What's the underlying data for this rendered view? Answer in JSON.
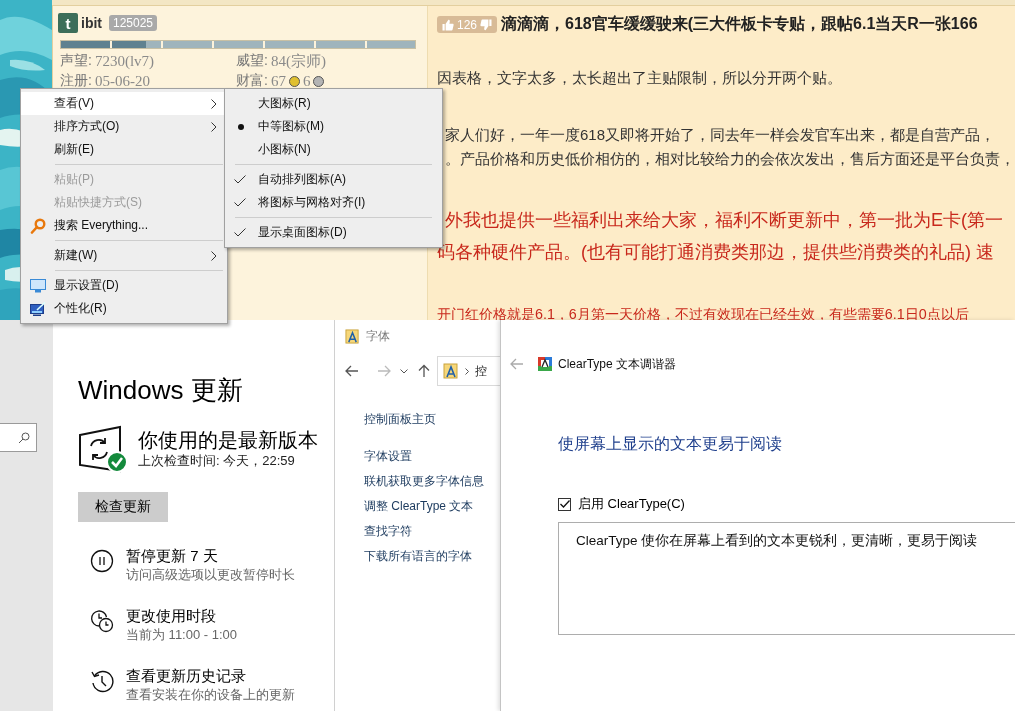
{
  "forum_post": {
    "author": {
      "avatar_letter": "t",
      "name": "ibit",
      "badge": "125025",
      "level": 0.24,
      "stats": [
        {
          "label": "声望:",
          "value": "7230(lv7)"
        },
        {
          "label": "威望:",
          "value": "84(宗师)"
        },
        {
          "label": "注册:",
          "value": "05-06-20"
        }
      ],
      "wealth": {
        "label": "财富:",
        "coins": [
          {
            "amount": "67",
            "color": "#e0c030"
          },
          {
            "amount": "6",
            "color": "#b4b4b4"
          }
        ]
      }
    },
    "votes": "126",
    "title": "滴滴滴，618官车缓缓驶来(三大件板卡专贴，跟帖6.1当天R一张166",
    "paragraphs": [
      {
        "kind": "normal",
        "lines": [
          "因表格，文字太多，太长超出了主贴限制，所以分开两个贴。"
        ]
      },
      {
        "kind": "normal",
        "lines": [
          "家人们好，一年一度618又即将开始了，同去年一样会发官车出来，都是自营产品，",
          "。产品价格和历史低价相仿的，相对比较给力的会依次发出，售后方面还是平台负责，"
        ]
      },
      {
        "kind": "highlight",
        "lines": [
          "外我也提供一些福利出来给大家，福利不断更新中，第一批为E卡(第一",
          "码各种硬件产品。(也有可能打通消费类那边，提供些消费类的礼品) 速"
        ]
      },
      {
        "kind": "highlight",
        "lines": [
          "开门红价格就是6.1，6月第一天价格，不过有效现在已经生效，有些需要6.1日0点以后"
        ]
      }
    ]
  },
  "context_menu": {
    "items": [
      {
        "kind": "item",
        "label": "查看(V)",
        "submenu": true,
        "selected": true,
        "disabled": false
      },
      {
        "kind": "item",
        "label": "排序方式(O)",
        "submenu": true,
        "selected": false,
        "disabled": false
      },
      {
        "kind": "item",
        "label": "刷新(E)",
        "submenu": false,
        "selected": false,
        "disabled": false
      },
      {
        "kind": "separator"
      },
      {
        "kind": "item",
        "label": "粘贴(P)",
        "submenu": false,
        "selected": false,
        "disabled": true
      },
      {
        "kind": "item",
        "label": "粘贴快捷方式(S)",
        "submenu": false,
        "selected": false,
        "disabled": true
      },
      {
        "kind": "search",
        "label": "搜索 Everything...",
        "submenu": false,
        "selected": false,
        "disabled": false
      },
      {
        "kind": "separator"
      },
      {
        "kind": "item",
        "label": "新建(W)",
        "submenu": true,
        "selected": false,
        "disabled": false
      },
      {
        "kind": "separator"
      },
      {
        "kind": "display",
        "label": "显示设置(D)",
        "submenu": false,
        "selected": false,
        "disabled": false
      },
      {
        "kind": "personalize",
        "label": "个性化(R)",
        "submenu": false,
        "selected": false,
        "disabled": false
      }
    ]
  },
  "view_submenu": {
    "items": [
      {
        "kind": "radio",
        "label": "大图标(R)",
        "selected": false
      },
      {
        "kind": "radio",
        "label": "中等图标(M)",
        "selected": true
      },
      {
        "kind": "radio",
        "label": "小图标(N)",
        "selected": false
      },
      {
        "kind": "separator"
      },
      {
        "kind": "check",
        "label": "自动排列图标(A)",
        "checked": true
      },
      {
        "kind": "check",
        "label": "将图标与网格对齐(I)",
        "checked": true
      },
      {
        "kind": "separator"
      },
      {
        "kind": "check",
        "label": "显示桌面图标(D)",
        "checked": true
      }
    ]
  },
  "settings_window": {
    "title": "Windows 更新",
    "status": "你使用的是最新版本",
    "last_checked": "上次检查时间: 今天，22:59",
    "button": "检查更新",
    "options": [
      {
        "kind": "pause",
        "title": "暂停更新 7 天",
        "subtitle": "访问高级选项以更改暂停时长"
      },
      {
        "kind": "active_hours",
        "title": "更改使用时段",
        "subtitle": "当前为 11:00 - 1:00"
      },
      {
        "kind": "history",
        "title": "查看更新历史记录",
        "subtitle": "查看安装在你的设备上的更新"
      }
    ]
  },
  "fonts_window": {
    "title": "字体",
    "address": "控",
    "links": [
      "控制面板主页",
      "字体设置",
      "联机获取更多字体信息",
      "调整 ClearType 文本",
      "查找字符",
      "下载所有语言的字体"
    ]
  },
  "cleartype_window": {
    "title": "ClearType 文本调谐器",
    "heading": "使屏幕上显示的文本更易于阅读",
    "checkbox": {
      "label": "启用 ClearType(C)",
      "checked": true
    },
    "description": "ClearType 使你在屏幕上看到的文本更锐利，更清晰，更易于阅读"
  }
}
